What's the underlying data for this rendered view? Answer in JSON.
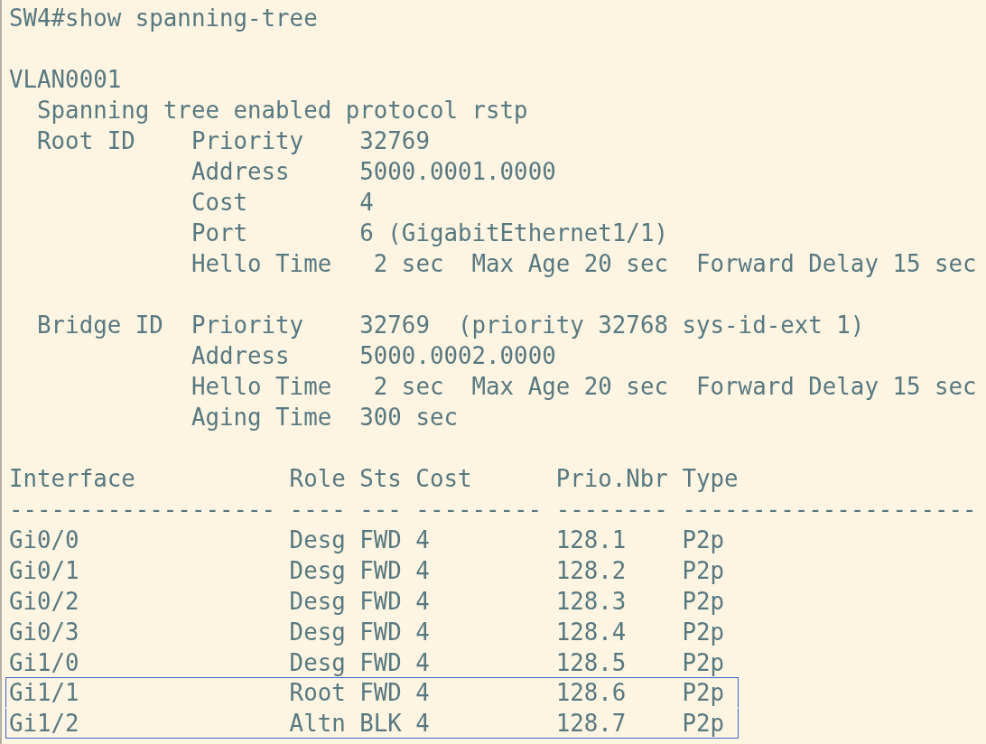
{
  "terminal": {
    "blocks": [
      {
        "lines": [
          "SW4#show spanning-tree"
        ]
      },
      {
        "lines": [
          "VLAN0001",
          "  Spanning tree enabled protocol rstp",
          "  Root ID    Priority    32769",
          "             Address     5000.0001.0000",
          "             Cost        4",
          "             Port        6 (GigabitEthernet1/1)",
          "             Hello Time   2 sec  Max Age 20 sec  Forward Delay 15 sec"
        ]
      },
      {
        "lines": [
          "  Bridge ID  Priority    32769  (priority 32768 sys-id-ext 1)",
          "             Address     5000.0002.0000",
          "             Hello Time   2 sec  Max Age 20 sec  Forward Delay 15 sec",
          "             Aging Time  300 sec"
        ]
      }
    ],
    "table": {
      "columns": [
        "Interface",
        "Role",
        "Sts",
        "Cost",
        "Prio.Nbr",
        "Type"
      ],
      "separator": [
        "-------------------",
        "----",
        "---",
        "---------",
        "--------",
        "---------------------"
      ],
      "rows": [
        {
          "cells": [
            "Gi0/0",
            "Desg",
            "FWD",
            "4",
            "128.1",
            "P2p"
          ],
          "highlighted": false
        },
        {
          "cells": [
            "Gi0/1",
            "Desg",
            "FWD",
            "4",
            "128.2",
            "P2p"
          ],
          "highlighted": false
        },
        {
          "cells": [
            "Gi0/2",
            "Desg",
            "FWD",
            "4",
            "128.3",
            "P2p"
          ],
          "highlighted": false
        },
        {
          "cells": [
            "Gi0/3",
            "Desg",
            "FWD",
            "4",
            "128.4",
            "P2p"
          ],
          "highlighted": false
        },
        {
          "cells": [
            "Gi1/0",
            "Desg",
            "FWD",
            "4",
            "128.5",
            "P2p"
          ],
          "highlighted": false
        },
        {
          "cells": [
            "Gi1/1",
            "Root",
            "FWD",
            "4",
            "128.6",
            "P2p"
          ],
          "highlighted": true
        },
        {
          "cells": [
            "Gi1/2",
            "Altn",
            "BLK",
            "4",
            "128.7",
            "P2p"
          ],
          "highlighted": true
        }
      ]
    }
  }
}
